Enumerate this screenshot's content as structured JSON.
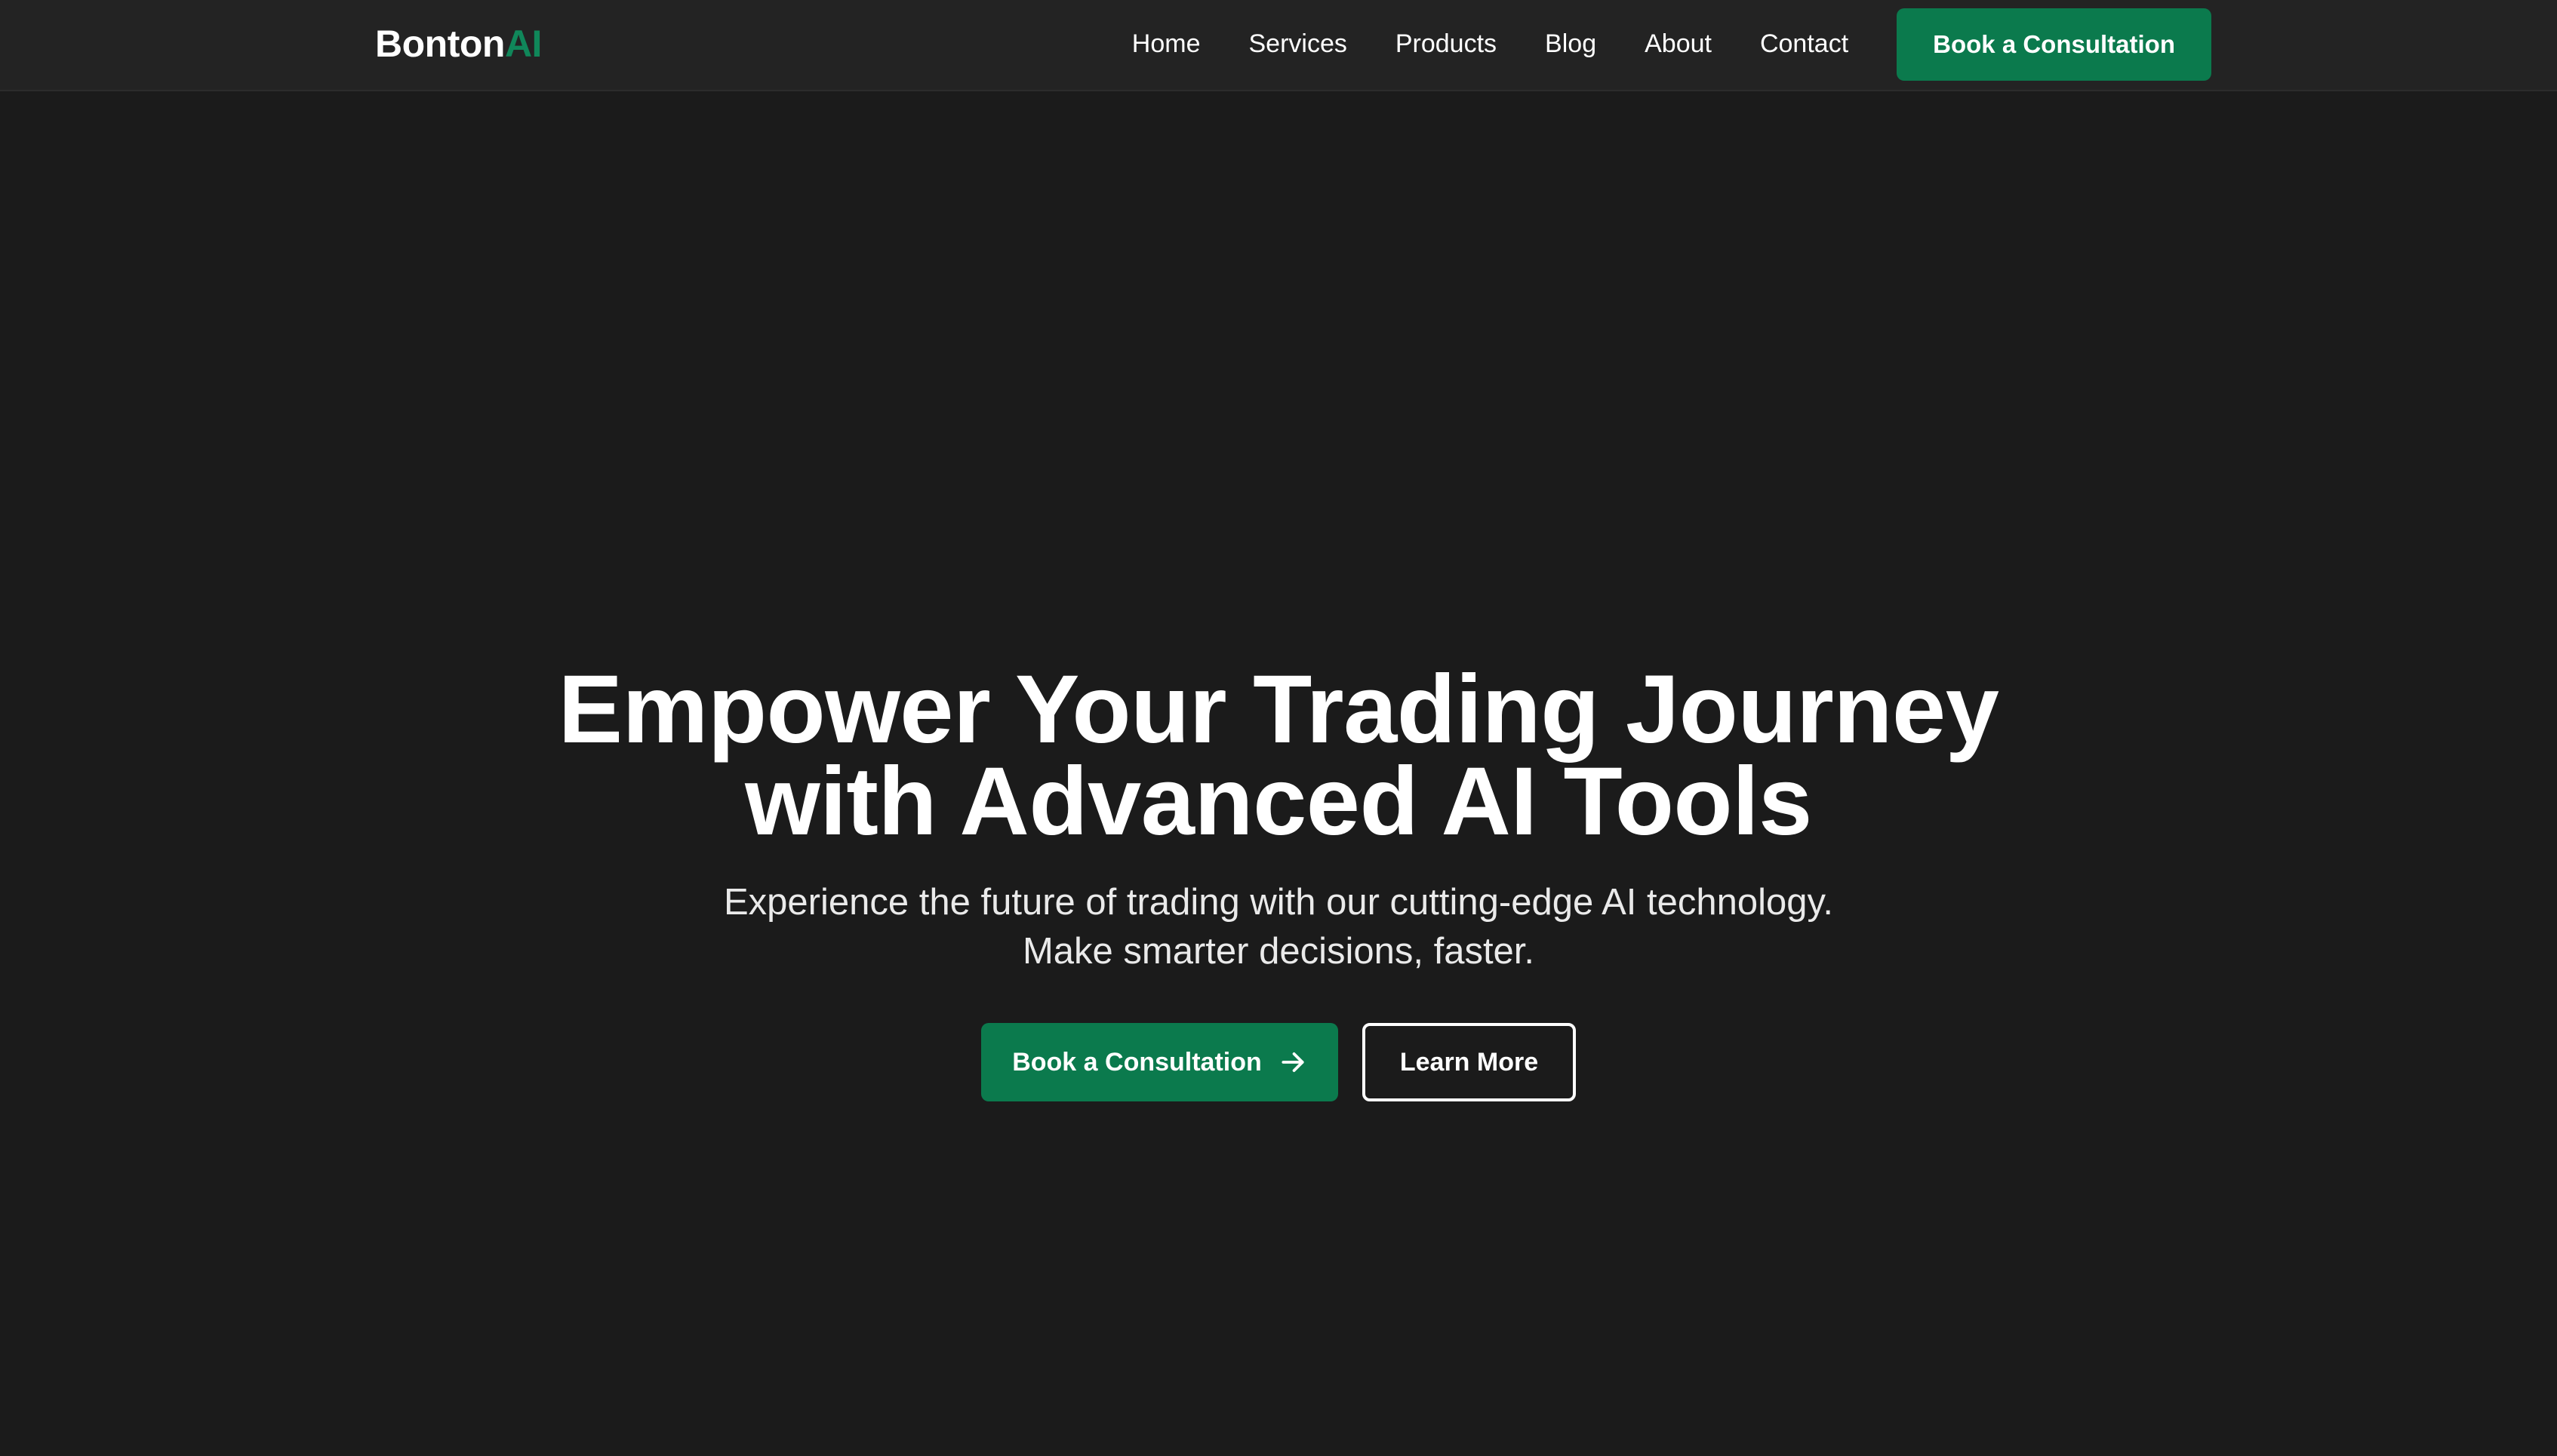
{
  "brand": {
    "name_main": "Bonton",
    "name_accent": "AI",
    "accent_color": "#10875a"
  },
  "nav": {
    "items": [
      {
        "label": "Home"
      },
      {
        "label": "Services"
      },
      {
        "label": "Products"
      },
      {
        "label": "Blog"
      },
      {
        "label": "About"
      },
      {
        "label": "Contact"
      }
    ],
    "cta_label": "Book a Consultation"
  },
  "hero": {
    "title_line1": "Empower Your Trading Journey",
    "title_line2": "with Advanced AI Tools",
    "subtitle_line1": "Experience the future of trading with our cutting-edge AI technology.",
    "subtitle_line2": "Make smarter decisions, faster.",
    "primary_button_label": "Book a Consultation",
    "primary_button_icon": "arrow-right-icon",
    "secondary_button_label": "Learn More"
  },
  "colors": {
    "background": "#1b1b1b",
    "header_background": "#232323",
    "primary_green": "#0b7a4d",
    "text": "#ffffff"
  }
}
